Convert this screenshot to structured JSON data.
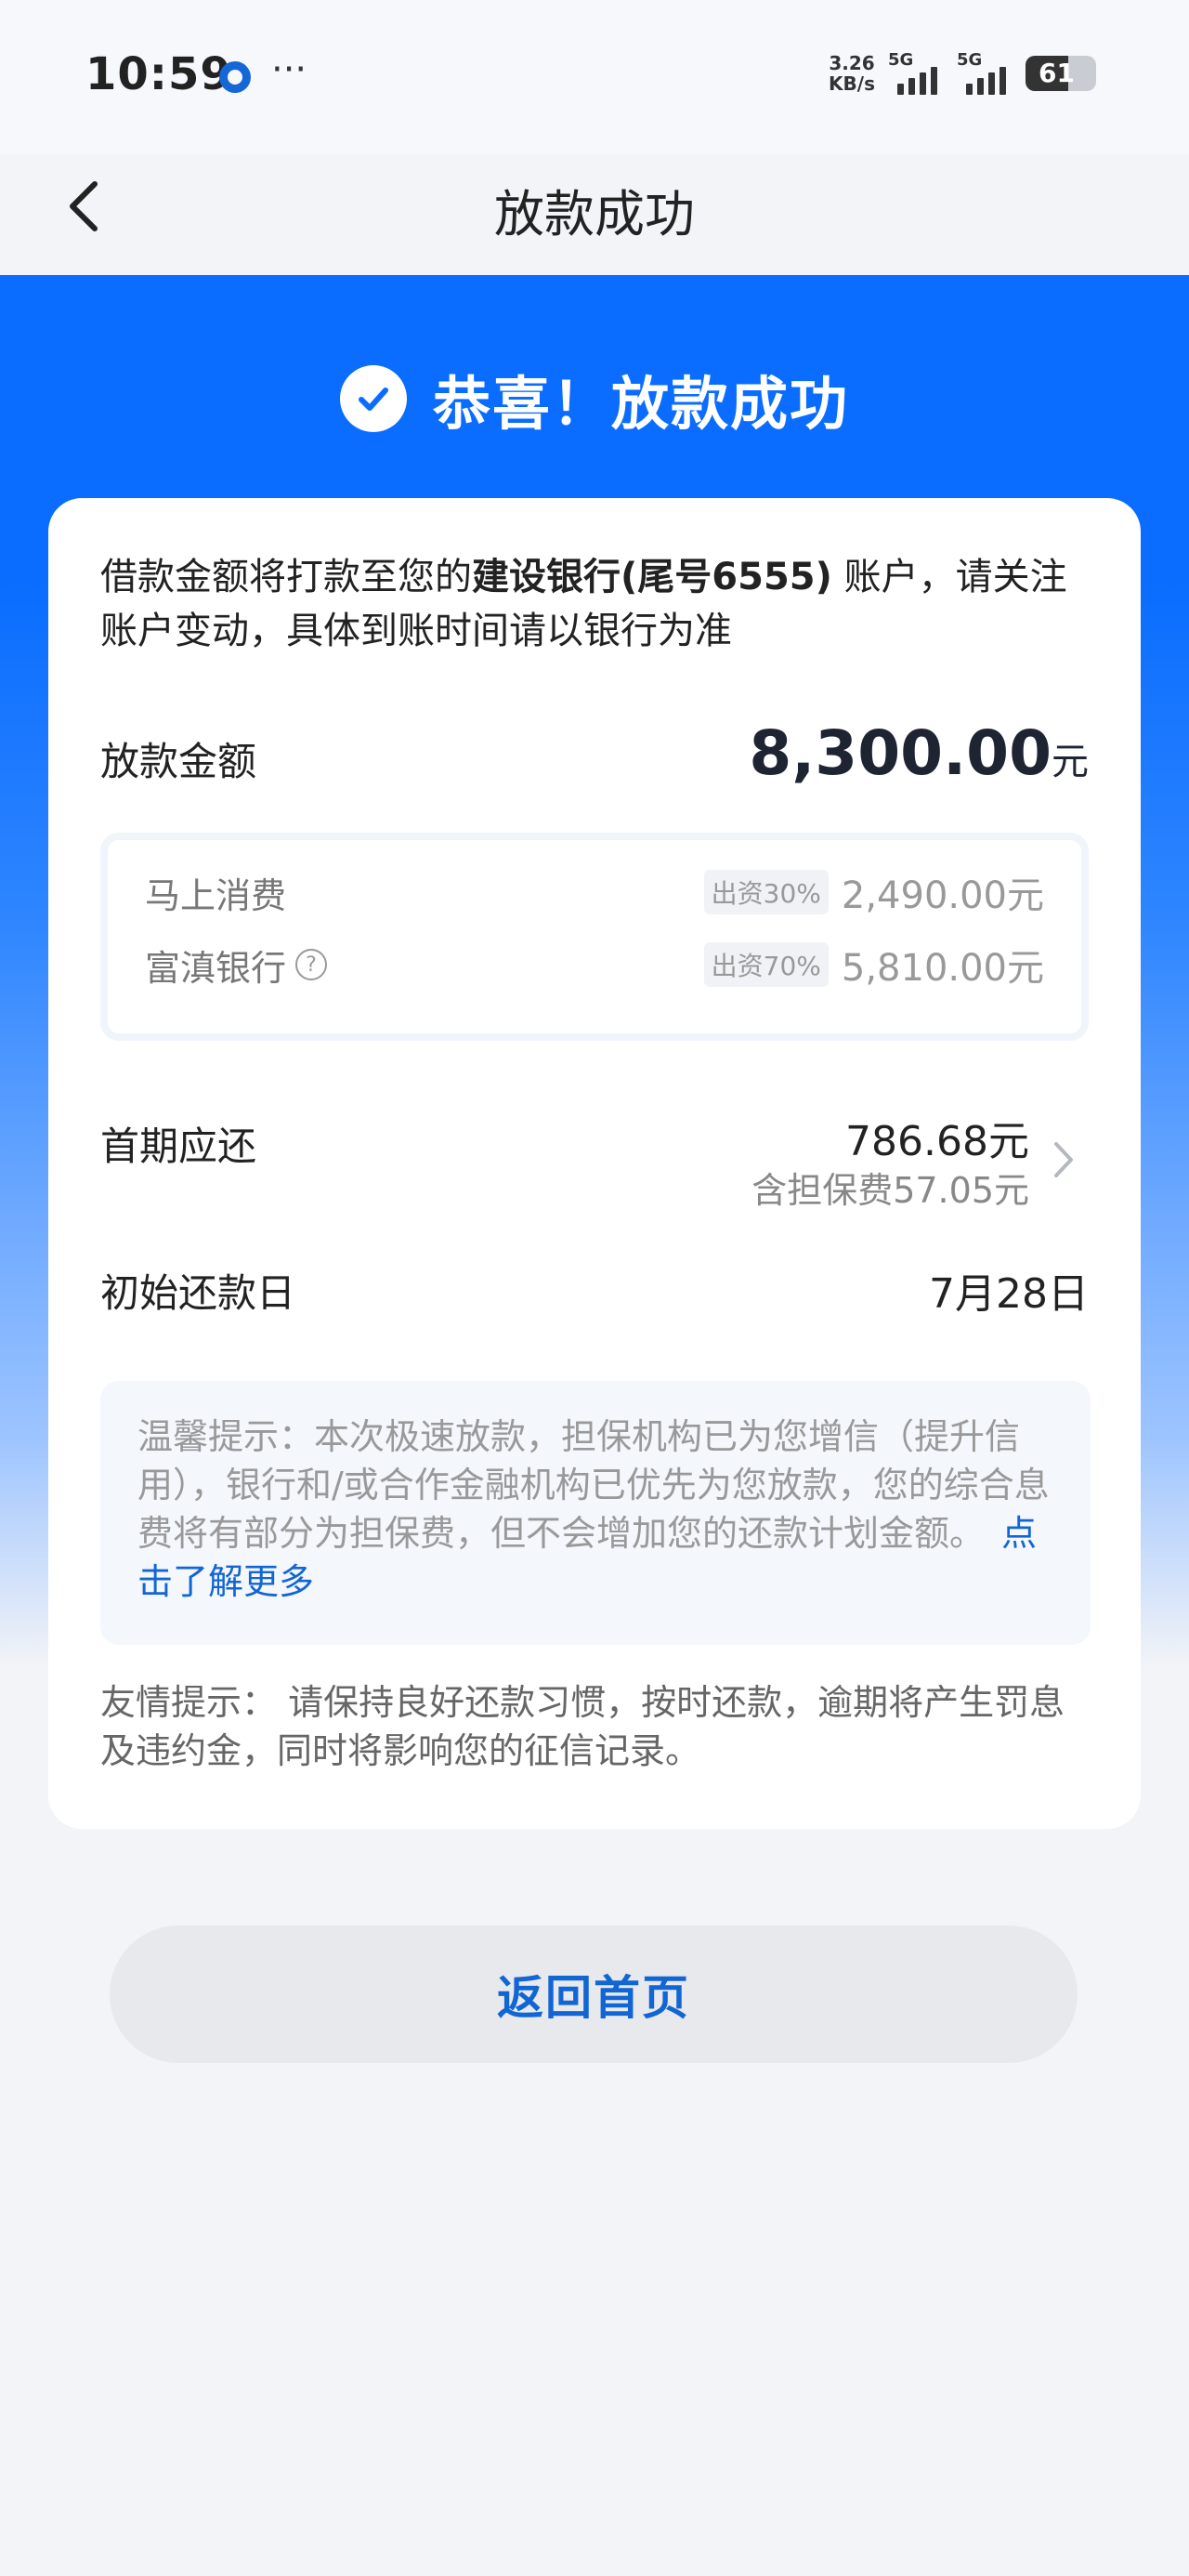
{
  "status_bar": {
    "time": "10:59",
    "more": "···",
    "net_speed_value": "3.26",
    "net_speed_unit": "KB/s",
    "signal1_label": "5G",
    "signal2_label": "5G",
    "battery": "61",
    "battery_level": 0.61
  },
  "nav": {
    "title": "放款成功"
  },
  "hero": {
    "text": "恭喜！放款成功"
  },
  "card": {
    "notice_prefix": "借款金额将打款至您的",
    "notice_bank": "建设银行(尾号6555)",
    "notice_suffix": " 账户，请关注账户变动，具体到账时间请以银行为准",
    "loan_label": "放款金额",
    "loan_amount": "8,300.00",
    "loan_unit": "元",
    "funders": [
      {
        "name": "马上消费",
        "share": "出资30%",
        "amount": "2,490.00元"
      },
      {
        "name": "富滇银行",
        "share": "出资70%",
        "amount": "5,810.00元"
      }
    ],
    "help_icon": "?",
    "first_label": "首期应还",
    "first_amount": "786.68元",
    "first_fee": "含担保费57.05元",
    "start_label": "初始还款日",
    "start_date": "7月28日",
    "tip_text": "温馨提示：本次极速放款，担保机构已为您增信（提升信用），银行和/或合作金融机构已优先为您放款，您的综合息费将有部分为担保费，但不会增加您的还款计划金额。",
    "tip_link": "点击了解更多",
    "friendly_text": "友情提示： 请保持良好还款习惯，按时还款，逾期将产生罚息及违约金，同时将影响您的征信记录。"
  },
  "buttons": {
    "home": "返回首页"
  },
  "colors": {
    "brand_blue": "#0a6dff",
    "link_blue": "#1266d4"
  },
  "icons": [
    "back-arrow-icon",
    "check-circle-icon",
    "question-circle-icon",
    "chevron-right-icon"
  ]
}
